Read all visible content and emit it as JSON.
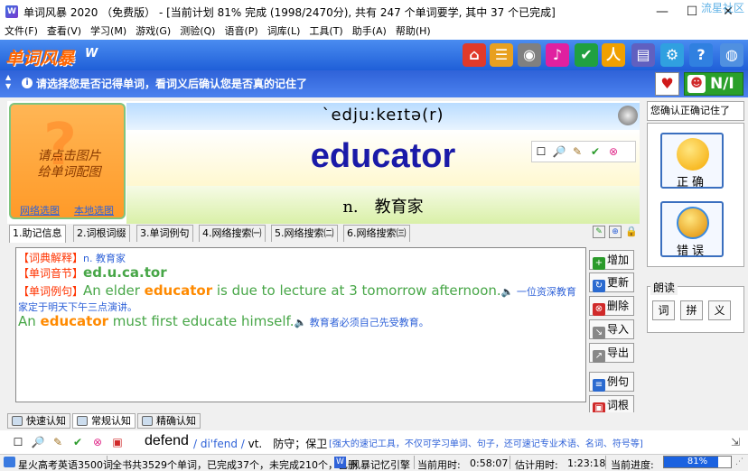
{
  "window": {
    "title": "单词风暴 2020 （免费版） - [当前计划 81% 完成 (1998/2470分), 共有 247 个单词要学, 其中 37 个已完成]",
    "watermark": "流星社区",
    "min": "—",
    "max": "☐",
    "close": "✕"
  },
  "menu": [
    "文件(F)",
    "查看(V)",
    "学习(M)",
    "游戏(G)",
    "测验(Q)",
    "语音(P)",
    "词库(L)",
    "工具(T)",
    "助手(A)",
    "帮助(H)"
  ],
  "toolbar": {
    "brand": "单词风暴",
    "brand_mark": "W",
    "icons": [
      {
        "name": "home-icon",
        "glyph": "⌂",
        "color": "#e03a2a"
      },
      {
        "name": "list-icon",
        "glyph": "☰",
        "color": "#e8a020"
      },
      {
        "name": "disc-icon",
        "glyph": "◉",
        "color": "#808080"
      },
      {
        "name": "music-icon",
        "glyph": "♪",
        "color": "#e020a0"
      },
      {
        "name": "shield-icon",
        "glyph": "✔",
        "color": "#20a040"
      },
      {
        "name": "runner-icon",
        "glyph": "人",
        "color": "#f0a000"
      },
      {
        "name": "books-icon",
        "glyph": "▤",
        "color": "#6060c0"
      },
      {
        "name": "gear-icon",
        "glyph": "⚙",
        "color": "#30a0e0"
      },
      {
        "name": "help-icon",
        "glyph": "?",
        "color": "#3080e0"
      },
      {
        "name": "globe-icon",
        "glyph": "◍",
        "color": "#5090e0"
      }
    ]
  },
  "hint": {
    "text": "请选择您是否记得单词，看词义后确认您是否真的记住了",
    "heart": "♥",
    "ni": "N/I"
  },
  "card": {
    "picture_hint": "请点击图片\n给单词配图",
    "web_pic": "网络选图",
    "local_pic": "本地选图",
    "phonetic": "`edju:keɪtə(r)",
    "word": "educator",
    "definition": "n.　教育家",
    "word_tools": [
      "☐",
      "🔎",
      "✎",
      "✔",
      "⊗"
    ]
  },
  "tabs": [
    "1.助记信息",
    "2.词根词缀",
    "3.单词例句",
    "4.网络搜索㈠",
    "5.网络搜索㈡",
    "6.网络搜索㈢"
  ],
  "content": {
    "dict_tag": "【词典解释】",
    "dict_val": "n. 教育家",
    "syll_tag": "【单词音节】",
    "syll_val": "ed.u.ca.tor",
    "ex_tag": "【单词例句】",
    "ex1_pre": "An elder ",
    "ex1_word": "educator",
    "ex1_post": " is due to lecture at 3 tomorrow afternoon.",
    "ex1_cn_a": "一位资深教育",
    "ex1_cn_b": "家定于明天下午三点演讲。",
    "ex2_pre": "An ",
    "ex2_word": "educator",
    "ex2_post": " must first educate himself.",
    "ex2_cn": "教育者必须自己先受教育。",
    "speaker": "🔈"
  },
  "side_buttons": [
    {
      "label": "增加",
      "color": "#2a9a2a",
      "glyph": "+"
    },
    {
      "label": "更新",
      "color": "#2a6ad0",
      "glyph": "↻"
    },
    {
      "label": "删除",
      "color": "#d02a2a",
      "glyph": "⊗"
    },
    {
      "label": "导入",
      "color": "#888888",
      "glyph": "↘"
    },
    {
      "label": "导出",
      "color": "#888888",
      "glyph": "↗"
    },
    {
      "label": "例句",
      "color": "#2a6ad0",
      "glyph": "≡"
    },
    {
      "label": "词根",
      "color": "#d02a2a",
      "glyph": "▣"
    }
  ],
  "right": {
    "question": "您确认正确记住了吗?",
    "correct": "正确",
    "wrong": "错误",
    "read_label": "朗读",
    "read_buttons": [
      "词",
      "拼",
      "义"
    ]
  },
  "mode_tabs": [
    "快速认知",
    "常规认知",
    "精确认知"
  ],
  "bottom_word": {
    "word": "defend",
    "phonetic": "/ di'fend /",
    "pos_def": "vt.　防守；保卫",
    "desc": "[强大的速记工具，不仅可学习单词、句子，还可速记专业术语、名词、符号等]"
  },
  "status": {
    "book": "星火高考英语3500词",
    "summary": "全书共3529个单词，已完成37个，未完成210个，已删",
    "engine_badge": "W",
    "engine": "风暴记忆引擎",
    "used_label": "当前用时:",
    "used": "0:58:07",
    "est_label": "估计用时:",
    "est": "1:23:18",
    "progress_label": "当前进度:",
    "progress_text": "81%",
    "progress_value": 0.81
  }
}
